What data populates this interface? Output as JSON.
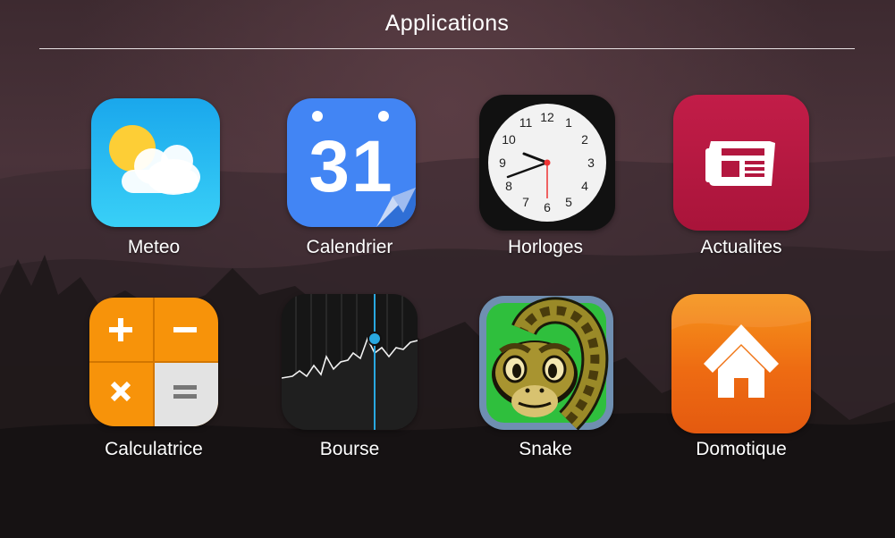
{
  "header": {
    "title": "Applications"
  },
  "apps": [
    {
      "label": "Meteo",
      "icon": "weather-icon"
    },
    {
      "label": "Calendrier",
      "icon": "calendar-icon",
      "day": "31"
    },
    {
      "label": "Horloges",
      "icon": "clock-icon",
      "numbers": [
        "12",
        "1",
        "2",
        "3",
        "4",
        "5",
        "6",
        "7",
        "8",
        "9",
        "10",
        "11"
      ]
    },
    {
      "label": "Actualites",
      "icon": "news-icon"
    },
    {
      "label": "Calculatrice",
      "icon": "calculator-icon"
    },
    {
      "label": "Bourse",
      "icon": "stocks-icon"
    },
    {
      "label": "Snake",
      "icon": "snake-icon"
    },
    {
      "label": "Domotique",
      "icon": "home-icon"
    }
  ],
  "colors": {
    "weather_bg": "#2cb8f0",
    "calendar_bg": "#4285f4",
    "news_bg": "#b3173f",
    "calculator_orange": "#f7930a",
    "home_bg": "#ee6b12"
  }
}
